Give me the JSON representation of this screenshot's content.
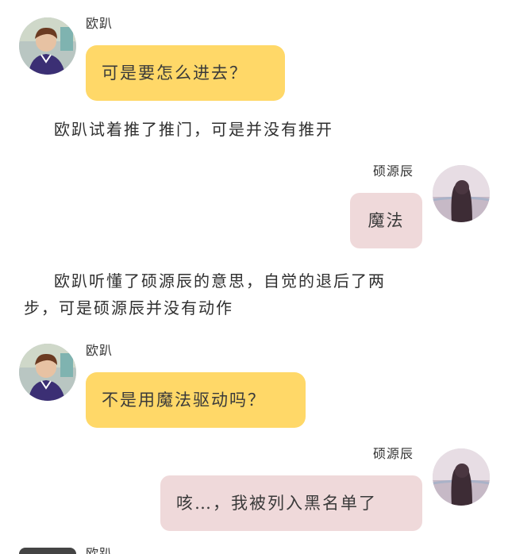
{
  "chat": {
    "messages": [
      {
        "speaker": "欧趴",
        "text": "可是要怎么进去？"
      },
      {
        "narration": "欧趴试着推了推门，可是并没有推开"
      },
      {
        "speaker": "硕源辰",
        "text": "魔法"
      },
      {
        "narration_line1": "欧趴听懂了硕源辰的意思，自觉的退后了两",
        "narration_line2": "步，可是硕源辰并没有动作"
      },
      {
        "speaker": "欧趴",
        "text": "不是用魔法驱动吗？"
      },
      {
        "speaker": "硕源辰",
        "text": "咳…，我被列入黑名单了"
      },
      {
        "speaker": "欧趴"
      }
    ]
  },
  "avatars": {
    "left_icon": "boy-avatar-icon",
    "right_icon": "girl-avatar-icon"
  },
  "colors": {
    "left_bubble": "#ffd868",
    "right_bubble": "#efd9da",
    "background": "#ffffff"
  }
}
